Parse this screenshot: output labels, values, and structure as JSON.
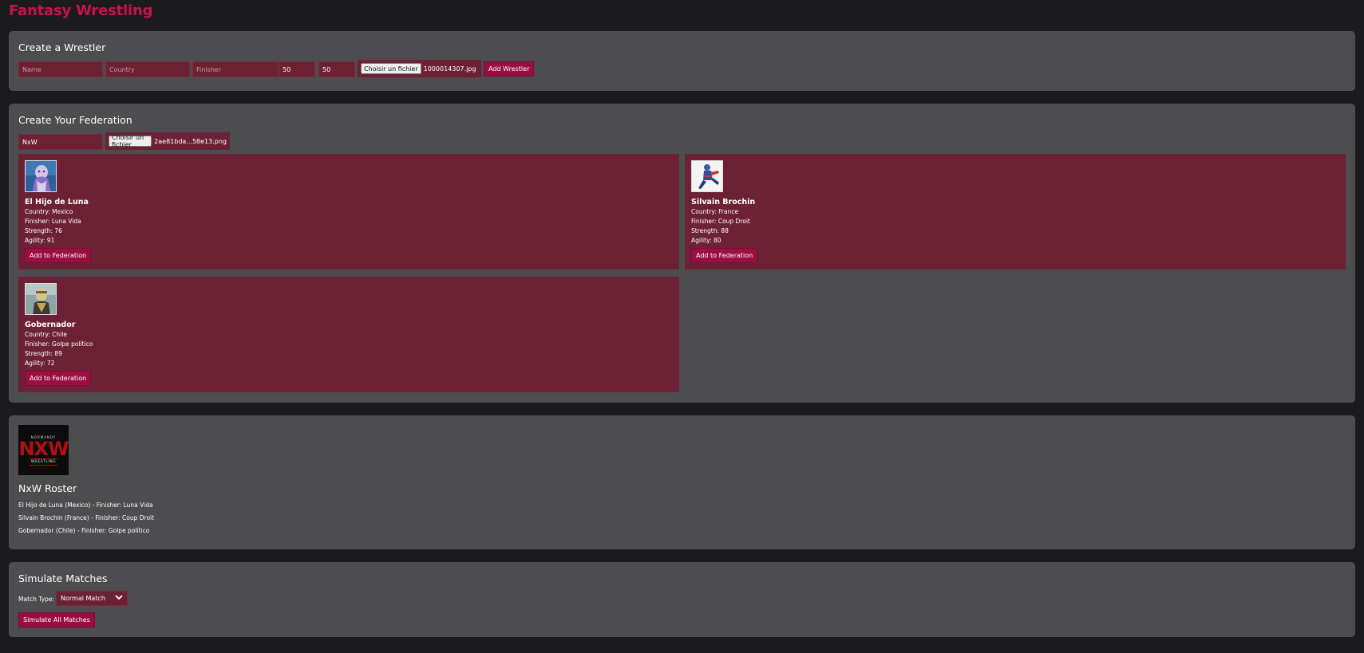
{
  "app": {
    "title": "Fantasy Wrestling"
  },
  "create_wrestler": {
    "heading": "Create a Wrestler",
    "name_placeholder": "Name",
    "country_placeholder": "Country",
    "finisher_placeholder": "Finisher",
    "strength_value": "50",
    "agility_value": "50",
    "file_button": "Choisir un fichier",
    "file_name": "1000014307.jpg",
    "submit_label": "Add Wrestler"
  },
  "federation": {
    "heading": "Create Your Federation",
    "name_value": "NxW",
    "file_button": "Choisir un fichier",
    "file_name": "2ae81bda...58e13.png",
    "wrestlers": [
      {
        "name": "El Hijo de Luna",
        "country": "Country: Mexico",
        "finisher": "Finisher: Luna Vida",
        "strength": "Strength: 76",
        "agility": "Agility: 91",
        "button": "Add to Federation"
      },
      {
        "name": "Silvain Brochin",
        "country": "Country: France",
        "finisher": "Finisher: Coup Droit",
        "strength": "Strength: 88",
        "agility": "Agility: 80",
        "button": "Add to Federation"
      },
      {
        "name": "Gobernador",
        "country": "Country: Chile",
        "finisher": "Finisher: Golpe político",
        "strength": "Strength: 89",
        "agility": "Agility: 72",
        "button": "Add to Federation"
      }
    ]
  },
  "roster": {
    "logo_text_top": "NORMANDY",
    "logo_text_main": "NXW",
    "logo_text_bottom": "WRESTLING",
    "heading": "NxW Roster",
    "items": [
      "El Hijo de Luna (Mexico) - Finisher: Luna Vida",
      "Silvain Brochin (France) - Finisher: Coup Droit",
      "Gobernador (Chile) - Finisher: Golpe político"
    ]
  },
  "simulate": {
    "heading": "Simulate Matches",
    "match_type_label": "Match Type:",
    "match_type_value": "Normal Match",
    "submit_label": "Simulate All Matches"
  },
  "colors": {
    "accent": "#c8124a",
    "button": "#9b0e43",
    "card": "#6d2134",
    "panel": "#4d4d4f",
    "background": "#1b1b1d"
  }
}
